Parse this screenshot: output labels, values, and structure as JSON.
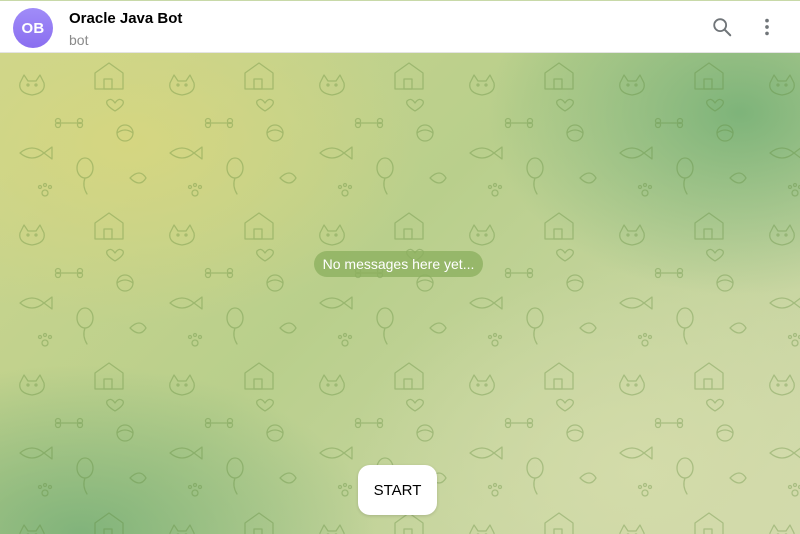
{
  "chat": {
    "avatar_initials": "OB",
    "title": "Oracle Java Bot",
    "subtitle": "bot"
  },
  "header": {
    "search_icon": "search-icon",
    "more_icon": "more-vertical-icon"
  },
  "messages": {
    "empty_text": "No messages here yet..."
  },
  "actions": {
    "start_label": "START"
  },
  "colors": {
    "avatar": "#8a6ef0",
    "pill": "#8caf5f",
    "background_light": "#d6d680",
    "background_green": "#7ab278"
  }
}
